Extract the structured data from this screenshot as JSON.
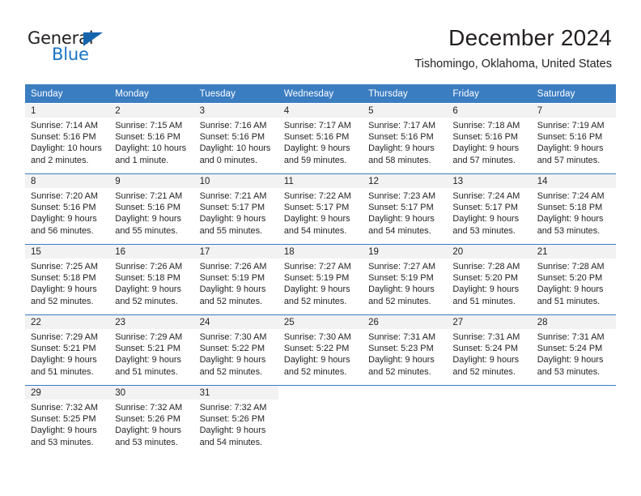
{
  "brand": {
    "name_top": "General",
    "name_bottom": "Blue",
    "triangle_color": "#1565ad",
    "blue_color": "#1874c4"
  },
  "header": {
    "title": "December 2024",
    "subtitle": "Tishomingo, Oklahoma, United States"
  },
  "theme": {
    "header_bg": "#3b7dc1",
    "daynum_bg": "#f2f2f2",
    "row_divider": "#3b7dc1",
    "text": "#231f20"
  },
  "weekdays": [
    "Sunday",
    "Monday",
    "Tuesday",
    "Wednesday",
    "Thursday",
    "Friday",
    "Saturday"
  ],
  "weeks": [
    [
      {
        "day": "1",
        "sunrise": "Sunrise: 7:14 AM",
        "sunset": "Sunset: 5:16 PM",
        "daylight": "Daylight: 10 hours and 2 minutes."
      },
      {
        "day": "2",
        "sunrise": "Sunrise: 7:15 AM",
        "sunset": "Sunset: 5:16 PM",
        "daylight": "Daylight: 10 hours and 1 minute."
      },
      {
        "day": "3",
        "sunrise": "Sunrise: 7:16 AM",
        "sunset": "Sunset: 5:16 PM",
        "daylight": "Daylight: 10 hours and 0 minutes."
      },
      {
        "day": "4",
        "sunrise": "Sunrise: 7:17 AM",
        "sunset": "Sunset: 5:16 PM",
        "daylight": "Daylight: 9 hours and 59 minutes."
      },
      {
        "day": "5",
        "sunrise": "Sunrise: 7:17 AM",
        "sunset": "Sunset: 5:16 PM",
        "daylight": "Daylight: 9 hours and 58 minutes."
      },
      {
        "day": "6",
        "sunrise": "Sunrise: 7:18 AM",
        "sunset": "Sunset: 5:16 PM",
        "daylight": "Daylight: 9 hours and 57 minutes."
      },
      {
        "day": "7",
        "sunrise": "Sunrise: 7:19 AM",
        "sunset": "Sunset: 5:16 PM",
        "daylight": "Daylight: 9 hours and 57 minutes."
      }
    ],
    [
      {
        "day": "8",
        "sunrise": "Sunrise: 7:20 AM",
        "sunset": "Sunset: 5:16 PM",
        "daylight": "Daylight: 9 hours and 56 minutes."
      },
      {
        "day": "9",
        "sunrise": "Sunrise: 7:21 AM",
        "sunset": "Sunset: 5:16 PM",
        "daylight": "Daylight: 9 hours and 55 minutes."
      },
      {
        "day": "10",
        "sunrise": "Sunrise: 7:21 AM",
        "sunset": "Sunset: 5:17 PM",
        "daylight": "Daylight: 9 hours and 55 minutes."
      },
      {
        "day": "11",
        "sunrise": "Sunrise: 7:22 AM",
        "sunset": "Sunset: 5:17 PM",
        "daylight": "Daylight: 9 hours and 54 minutes."
      },
      {
        "day": "12",
        "sunrise": "Sunrise: 7:23 AM",
        "sunset": "Sunset: 5:17 PM",
        "daylight": "Daylight: 9 hours and 54 minutes."
      },
      {
        "day": "13",
        "sunrise": "Sunrise: 7:24 AM",
        "sunset": "Sunset: 5:17 PM",
        "daylight": "Daylight: 9 hours and 53 minutes."
      },
      {
        "day": "14",
        "sunrise": "Sunrise: 7:24 AM",
        "sunset": "Sunset: 5:18 PM",
        "daylight": "Daylight: 9 hours and 53 minutes."
      }
    ],
    [
      {
        "day": "15",
        "sunrise": "Sunrise: 7:25 AM",
        "sunset": "Sunset: 5:18 PM",
        "daylight": "Daylight: 9 hours and 52 minutes."
      },
      {
        "day": "16",
        "sunrise": "Sunrise: 7:26 AM",
        "sunset": "Sunset: 5:18 PM",
        "daylight": "Daylight: 9 hours and 52 minutes."
      },
      {
        "day": "17",
        "sunrise": "Sunrise: 7:26 AM",
        "sunset": "Sunset: 5:19 PM",
        "daylight": "Daylight: 9 hours and 52 minutes."
      },
      {
        "day": "18",
        "sunrise": "Sunrise: 7:27 AM",
        "sunset": "Sunset: 5:19 PM",
        "daylight": "Daylight: 9 hours and 52 minutes."
      },
      {
        "day": "19",
        "sunrise": "Sunrise: 7:27 AM",
        "sunset": "Sunset: 5:19 PM",
        "daylight": "Daylight: 9 hours and 52 minutes."
      },
      {
        "day": "20",
        "sunrise": "Sunrise: 7:28 AM",
        "sunset": "Sunset: 5:20 PM",
        "daylight": "Daylight: 9 hours and 51 minutes."
      },
      {
        "day": "21",
        "sunrise": "Sunrise: 7:28 AM",
        "sunset": "Sunset: 5:20 PM",
        "daylight": "Daylight: 9 hours and 51 minutes."
      }
    ],
    [
      {
        "day": "22",
        "sunrise": "Sunrise: 7:29 AM",
        "sunset": "Sunset: 5:21 PM",
        "daylight": "Daylight: 9 hours and 51 minutes."
      },
      {
        "day": "23",
        "sunrise": "Sunrise: 7:29 AM",
        "sunset": "Sunset: 5:21 PM",
        "daylight": "Daylight: 9 hours and 51 minutes."
      },
      {
        "day": "24",
        "sunrise": "Sunrise: 7:30 AM",
        "sunset": "Sunset: 5:22 PM",
        "daylight": "Daylight: 9 hours and 52 minutes."
      },
      {
        "day": "25",
        "sunrise": "Sunrise: 7:30 AM",
        "sunset": "Sunset: 5:22 PM",
        "daylight": "Daylight: 9 hours and 52 minutes."
      },
      {
        "day": "26",
        "sunrise": "Sunrise: 7:31 AM",
        "sunset": "Sunset: 5:23 PM",
        "daylight": "Daylight: 9 hours and 52 minutes."
      },
      {
        "day": "27",
        "sunrise": "Sunrise: 7:31 AM",
        "sunset": "Sunset: 5:24 PM",
        "daylight": "Daylight: 9 hours and 52 minutes."
      },
      {
        "day": "28",
        "sunrise": "Sunrise: 7:31 AM",
        "sunset": "Sunset: 5:24 PM",
        "daylight": "Daylight: 9 hours and 53 minutes."
      }
    ],
    [
      {
        "day": "29",
        "sunrise": "Sunrise: 7:32 AM",
        "sunset": "Sunset: 5:25 PM",
        "daylight": "Daylight: 9 hours and 53 minutes."
      },
      {
        "day": "30",
        "sunrise": "Sunrise: 7:32 AM",
        "sunset": "Sunset: 5:26 PM",
        "daylight": "Daylight: 9 hours and 53 minutes."
      },
      {
        "day": "31",
        "sunrise": "Sunrise: 7:32 AM",
        "sunset": "Sunset: 5:26 PM",
        "daylight": "Daylight: 9 hours and 54 minutes."
      },
      {
        "day": "",
        "sunrise": "",
        "sunset": "",
        "daylight": ""
      },
      {
        "day": "",
        "sunrise": "",
        "sunset": "",
        "daylight": ""
      },
      {
        "day": "",
        "sunrise": "",
        "sunset": "",
        "daylight": ""
      },
      {
        "day": "",
        "sunrise": "",
        "sunset": "",
        "daylight": ""
      }
    ]
  ]
}
